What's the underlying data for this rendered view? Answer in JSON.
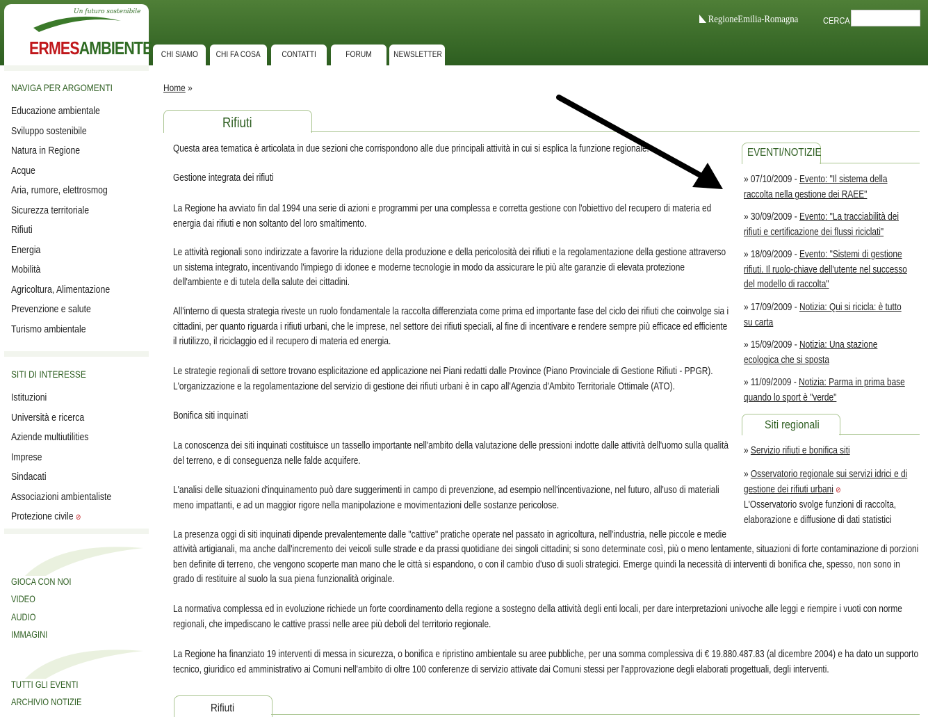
{
  "header": {
    "logo_tagline": "Un futuro sostenibile",
    "logo_part1": "ERMES",
    "logo_part2": "AMBIENTE",
    "region_logo": "RegioneEmilia-Romagna",
    "search_label": "CERCA",
    "search_value": ""
  },
  "tabs": [
    "CHI SIAMO",
    "CHI FA COSA",
    "CONTATTI",
    "FORUM",
    "NEWSLETTER"
  ],
  "sidebar": {
    "topics_heading": "NAVIGA PER ARGOMENTI",
    "topics": [
      "Educazione ambientale",
      "Sviluppo sostenibile",
      "Natura in Regione",
      "Acque",
      "Aria, rumore, elettrosmog",
      "Sicurezza territoriale",
      "Rifiuti",
      "Energia",
      "Mobilità",
      "Agricoltura, Alimentazione",
      "Prevenzione e salute",
      "Turismo ambientale"
    ],
    "sites_heading": "SITI DI INTERESSE",
    "sites": [
      "Istituzioni",
      "Università e ricerca",
      "Aziende multiutilities",
      "Imprese",
      "Sindacati",
      "Associazioni ambientaliste",
      "Protezione civile"
    ],
    "media": [
      "GIOCA CON NOI",
      "VIDEO",
      "AUDIO",
      "IMMAGINI"
    ],
    "archive": [
      "TUTTI GLI EVENTI",
      "ARCHIVIO NOTIZIE"
    ]
  },
  "main": {
    "breadcrumb_home": "Home",
    "breadcrumb_sep": "»",
    "section_title": "Rifiuti",
    "intro": "Questa area tematica è articolata in due sezioni che corrispondono alle due principali attività in cui si esplica la funzione regionale.",
    "heading1": "Gestione integrata dei rifiuti",
    "p1": "La Regione ha avviato fin dal 1994 una serie di azioni e programmi per una complessa e corretta gestione con l'obiettivo del recupero di materia ed energia dai rifiuti e non soltanto del loro smaltimento.",
    "p2": "Le attività regionali sono indirizzate a favorire la riduzione della produzione e della pericolosità dei rifiuti e la regolamentazione della gestione attraverso un sistema integrato, incentivando l'impiego di idonee e moderne tecnologie in modo da assicurare le più alte garanzie di elevata protezione dell'ambiente e di tutela della salute dei cittadini.",
    "p3": "All'interno di questa strategia riveste un ruolo fondamentale la raccolta differenziata come prima ed importante fase del ciclo dei rifiuti che coinvolge sia i cittadini, per quanto riguarda i rifiuti urbani, che le imprese, nel settore dei rifiuti speciali, al fine di incentivare e rendere sempre più efficace ed efficiente il riutilizzo, il riciclaggio ed il recupero di materia ed energia.",
    "p4a": "Le strategie regionali di settore trovano esplicitazione ed applicazione nei Piani redatti dalle Province (Piano Provinciale di Gestione Rifiuti - PPGR).",
    "p4b": "L'organizzazione e la regolamentazione del servizio di gestione dei rifiuti urbani è in capo all'Agenzia d'Ambito Territoriale Ottimale (ATO).",
    "heading2": "Bonifica siti inquinati",
    "p5": "La conoscenza dei siti inquinati costituisce un tassello importante nell'ambito della valutazione delle pressioni indotte dalle attività dell'uomo sulla qualità del terreno, e di conseguenza nelle falde acquifere.",
    "p6": "L'analisi delle situazioni d'inquinamento può dare suggerimenti in campo di prevenzione, ad esempio nell'incentivazione, nel futuro, all'uso di materiali meno impattanti, e ad un maggior rigore nella manipolazione e movimentazioni delle sostanze pericolose.",
    "p7a": "La presenza oggi di siti inquinati dipende prevalentemente dalle \"cattive\" pratiche operate nel passato in agricoltura, nell'industria, nelle piccole e medie",
    "p7b": "attività artigianali, ma anche dall'incremento dei veicoli sulle strade e da prassi quotidiane dei singoli cittadini; si sono determinate così, più o meno lentamente, situazioni di forte contaminazione di porzioni ben definite di terreno, che vengono scoperte man mano che le città si espandono, o con il cambio d'uso di suoli strategici. Emerge quindi la necessità di interventi di bonifica che, spesso, non sono in grado di restituire al suolo la sua piena funzionalità originale.",
    "p8": "La normativa complessa ed in evoluzione richiede un forte coordinamento della regione a sostegno della attività degli enti locali, per dare interpretazioni univoche alle leggi e riempire i vuoti con norme regionali, che impediscano le cattive prassi nelle aree più deboli del territorio regionale.",
    "p9": "La Regione ha finanziato 19 interventi di messa in sicurezza, o bonifica e ripristino ambientale su aree pubbliche, per una somma complessiva di € 19.880.487.83 (al dicembre 2004) e ha dato un supporto tecnico, giuridico ed amministrativo ai Comuni nell'ambito di oltre 100 conferenze di servizio attivate dai Comuni stessi per l'approvazione degli elaborati progettuali, degli interventi.",
    "footer_tab": "Rifiuti"
  },
  "events": {
    "heading": "EVENTI/NOTIZIE",
    "items": [
      {
        "date": "07/10/2009",
        "link": "Evento: \"Il sistema della raccolta nella gestione dei RAEE\""
      },
      {
        "date": "30/09/2009",
        "link": "Evento: \"La tracciabilità dei rifiuti e certificazione dei flussi riciclati\""
      },
      {
        "date": "18/09/2009",
        "link": "Evento: \"Sistemi di gestione rifiuti. Il ruolo-chiave dell'utente nel successo del modello di raccolta\""
      },
      {
        "date": "17/09/2009",
        "link": "Notizia: Qui si ricicla: è tutto su carta"
      },
      {
        "date": "15/09/2009",
        "link": "Notizia: Una stazione ecologica che si sposta"
      },
      {
        "date": "11/09/2009",
        "link": "Notizia: Parma in prima base quando lo sport è \"verde\""
      }
    ]
  },
  "regional_sites": {
    "heading": "Siti regionali",
    "item1": "Servizio rifiuti e bonifica siti",
    "item2": "Osservatorio regionale sui servizi idrici e di gestione dei rifiuti urbani",
    "item2_desc": "L'Osservatorio svolge funzioni di raccolta, elaborazione e diffusione di dati statistici"
  },
  "icons": {
    "bullet": "»",
    "external_link": "external-link-icon"
  },
  "colors": {
    "brand_green": "#2d5e20",
    "header_green": "#4f7f37",
    "logo_red": "#c0171b",
    "tab_border": "#a9c48f"
  }
}
